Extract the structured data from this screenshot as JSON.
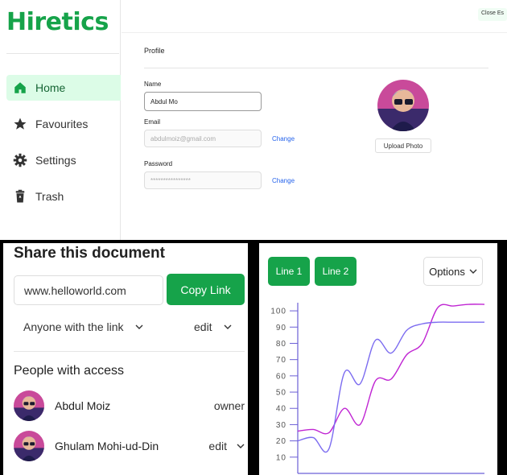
{
  "app": {
    "logo": "Hiretics",
    "topbar_button": "Close Es"
  },
  "sidebar": {
    "items": [
      {
        "label": "Home",
        "icon": "home-icon",
        "active": true
      },
      {
        "label": "Favourites",
        "icon": "star-icon"
      },
      {
        "label": "Settings",
        "icon": "gear-icon"
      },
      {
        "label": "Trash",
        "icon": "trash-icon"
      }
    ]
  },
  "profile": {
    "title": "Profile",
    "name_label": "Name",
    "name_value": "Abdul Mo",
    "email_label": "Email",
    "email_value": "abdulmoiz@gmail.com",
    "password_label": "Password",
    "password_value": "****************",
    "change_label": "Change",
    "upload_label": "Upload Photo"
  },
  "share": {
    "title": "Share this document",
    "url": "www.helloworld.com",
    "copy_label": "Copy Link",
    "access_scope": "Anyone with the link",
    "access_level": "edit",
    "people_title": "People with access",
    "people": [
      {
        "name": "Abdul Moiz",
        "role": "owner"
      },
      {
        "name": "Ghulam Mohi-ud-Din",
        "role": "edit"
      }
    ]
  },
  "chart_panel": {
    "line1_label": "Line 1",
    "line2_label": "Line 2",
    "options_label": "Options"
  },
  "colors": {
    "accent": "#16a34a",
    "accent_light": "#dcfce7",
    "line1": "#c026d3",
    "line2": "#7c6cf0"
  },
  "chart_data": {
    "type": "line",
    "ylim": [
      0,
      105
    ],
    "yticks": [
      10,
      20,
      30,
      40,
      50,
      60,
      70,
      80,
      90,
      100
    ],
    "x": [
      0,
      1,
      2,
      3,
      4,
      5,
      6,
      7,
      8,
      9,
      10,
      11,
      12
    ],
    "series": [
      {
        "name": "Line 1",
        "values": [
          26,
          27,
          25,
          40,
          30,
          57,
          58,
          73,
          80,
          102,
          103,
          104,
          104
        ]
      },
      {
        "name": "Line 2",
        "values": [
          20,
          22,
          15,
          62,
          55,
          82,
          74,
          88,
          92,
          93,
          93,
          93,
          93
        ]
      }
    ]
  }
}
